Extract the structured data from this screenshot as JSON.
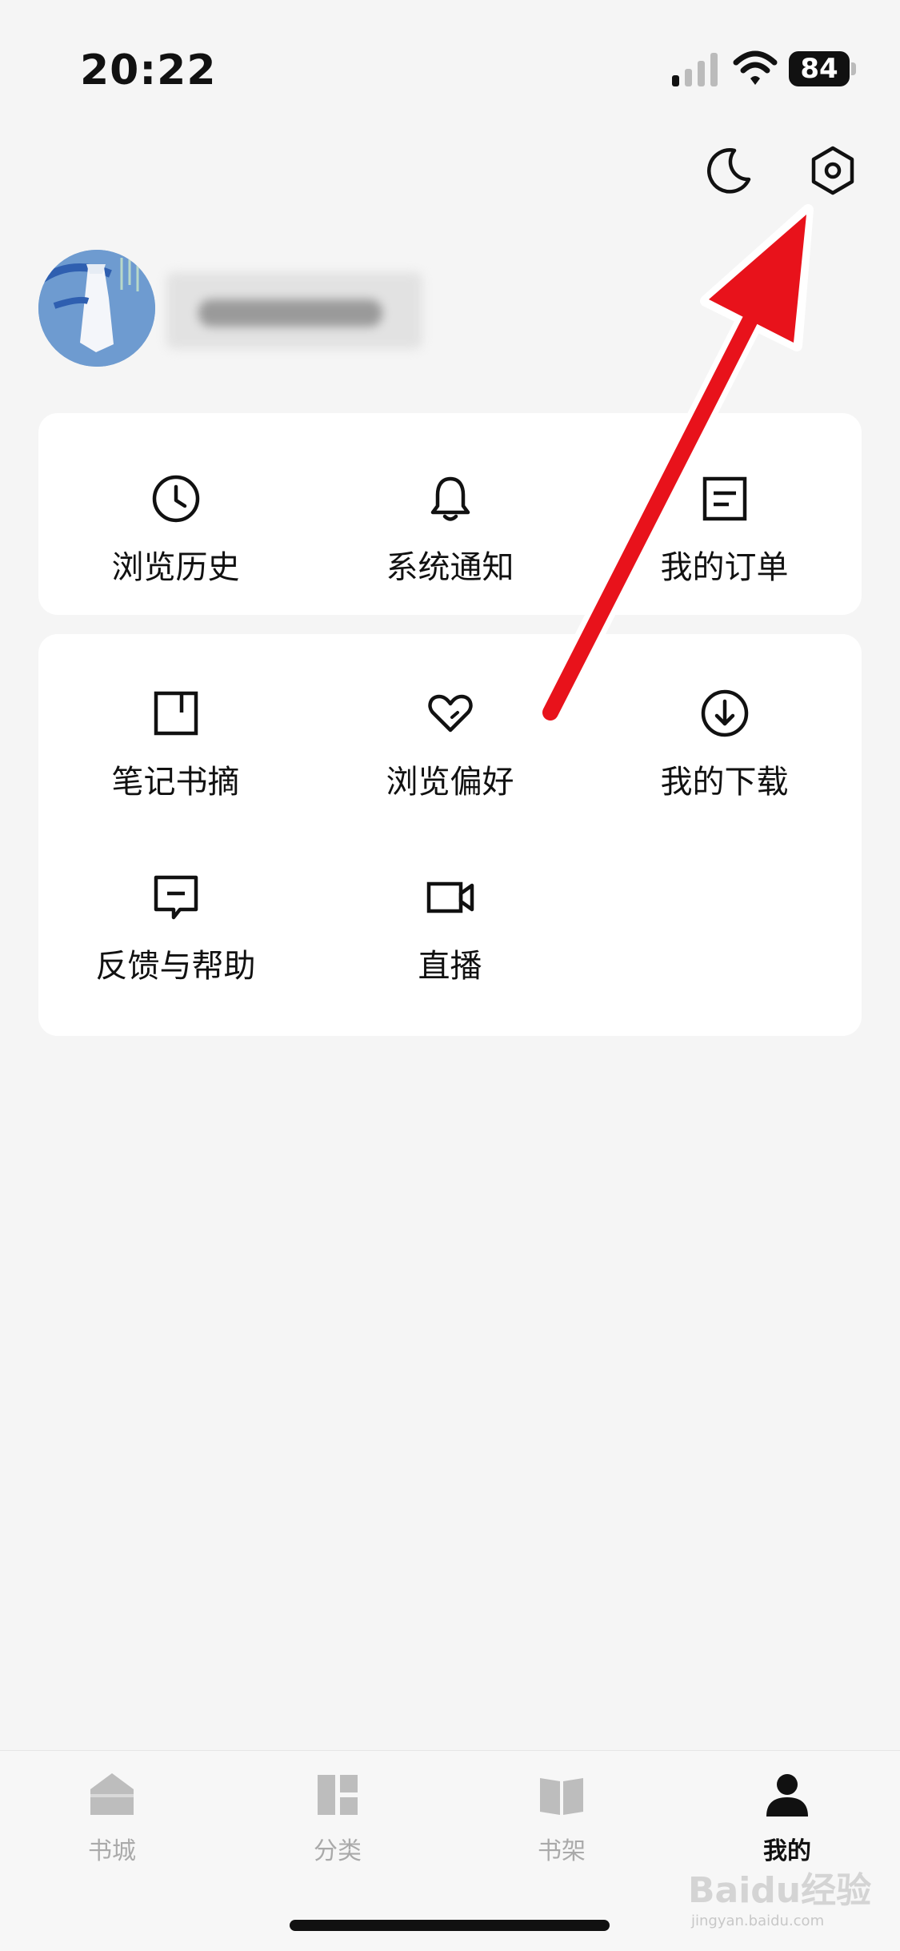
{
  "status_bar": {
    "time": "20:22",
    "battery": "84"
  },
  "header": {
    "actions": [
      "moon-icon",
      "gear-icon"
    ]
  },
  "profile": {
    "avatar": "avatar-image"
  },
  "card_primary": {
    "items": [
      {
        "label": "浏览历史",
        "icon": "clock-icon"
      },
      {
        "label": "系统通知",
        "icon": "bell-icon"
      },
      {
        "label": "我的订单",
        "icon": "order-icon"
      }
    ]
  },
  "card_secondary": {
    "items": [
      {
        "label": "笔记书摘",
        "icon": "bookmark-icon"
      },
      {
        "label": "浏览偏好",
        "icon": "heart-icon"
      },
      {
        "label": "我的下载",
        "icon": "download-icon"
      },
      {
        "label": "反馈与帮助",
        "icon": "feedback-icon"
      },
      {
        "label": "直播",
        "icon": "video-icon"
      }
    ]
  },
  "tab_bar": {
    "tabs": [
      {
        "label": "书城",
        "icon": "home-icon"
      },
      {
        "label": "分类",
        "icon": "category-icon"
      },
      {
        "label": "书架",
        "icon": "book-icon"
      },
      {
        "label": "我的",
        "icon": "person-icon",
        "active": true
      }
    ]
  },
  "watermark": {
    "main": "Baidu经验",
    "sub": "jingyan.baidu.com"
  },
  "colors": {
    "background": "#f5f5f5",
    "card": "#ffffff",
    "annotation_arrow": "#e8121b",
    "tab_inactive": "#aaaaaa",
    "tab_active": "#111111"
  }
}
